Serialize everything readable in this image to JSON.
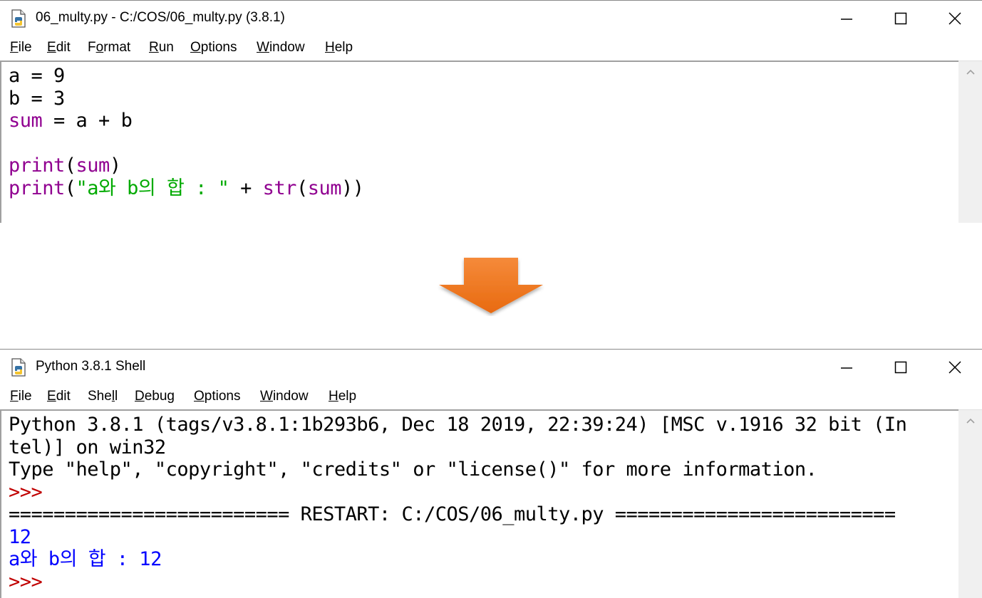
{
  "editor": {
    "title": "06_multy.py - C:/COS/06_multy.py (3.8.1)",
    "menu": [
      {
        "acc": "F",
        "rest": "ile"
      },
      {
        "acc": "E",
        "rest": "dit"
      },
      {
        "pre": "F",
        "acc": "o",
        "rest": "rmat"
      },
      {
        "acc": "R",
        "rest": "un"
      },
      {
        "acc": "O",
        "rest": "ptions"
      },
      {
        "acc": "W",
        "rest": "indow"
      },
      {
        "acc": "H",
        "rest": "elp"
      }
    ],
    "code": {
      "line1": "a = 9",
      "line2": "b = 3",
      "line3_builtin": "sum",
      "line3_rest": " = a + b",
      "line5_builtin": "print",
      "line5_open": "(",
      "line5_arg": "sum",
      "line5_close": ")",
      "line6_builtin": "print",
      "line6_open": "(",
      "line6_string": "\"a와 b의 합 : \"",
      "line6_plus": " + ",
      "line6_builtin2": "str",
      "line6_open2": "(",
      "line6_arg": "sum",
      "line6_close": "))"
    }
  },
  "shell": {
    "title": "Python 3.8.1 Shell",
    "menu": [
      {
        "acc": "F",
        "rest": "ile"
      },
      {
        "acc": "E",
        "rest": "dit"
      },
      {
        "pre": "She",
        "acc": "l",
        "rest": "l"
      },
      {
        "acc": "D",
        "rest": "ebug"
      },
      {
        "acc": "O",
        "rest": "ptions"
      },
      {
        "acc": "W",
        "rest": "indow"
      },
      {
        "acc": "H",
        "rest": "elp"
      }
    ],
    "output": {
      "banner1": "Python 3.8.1 (tags/v3.8.1:1b293b6, Dec 18 2019, 22:39:24) [MSC v.1916 32 bit (In",
      "banner2": "tel)] on win32",
      "banner3": "Type \"help\", \"copyright\", \"credits\" or \"license()\" for more information.",
      "prompt1": ">>> ",
      "restart": "========================= RESTART: C:/COS/06_multy.py =========================",
      "result1": "12",
      "result2": "a와 b의 합 : 12",
      "prompt2": ">>> "
    }
  },
  "colors": {
    "builtin": "#900090",
    "string": "#00aa00",
    "stdout": "#0000ff",
    "prompt": "#c00000",
    "arrow": "#f07820"
  },
  "icons": {
    "app": "python-file-icon",
    "minimize": "minimize-icon",
    "maximize": "maximize-icon",
    "close": "close-icon",
    "scroll_up": "chevron-up-icon",
    "arrow": "arrow-down-icon"
  }
}
